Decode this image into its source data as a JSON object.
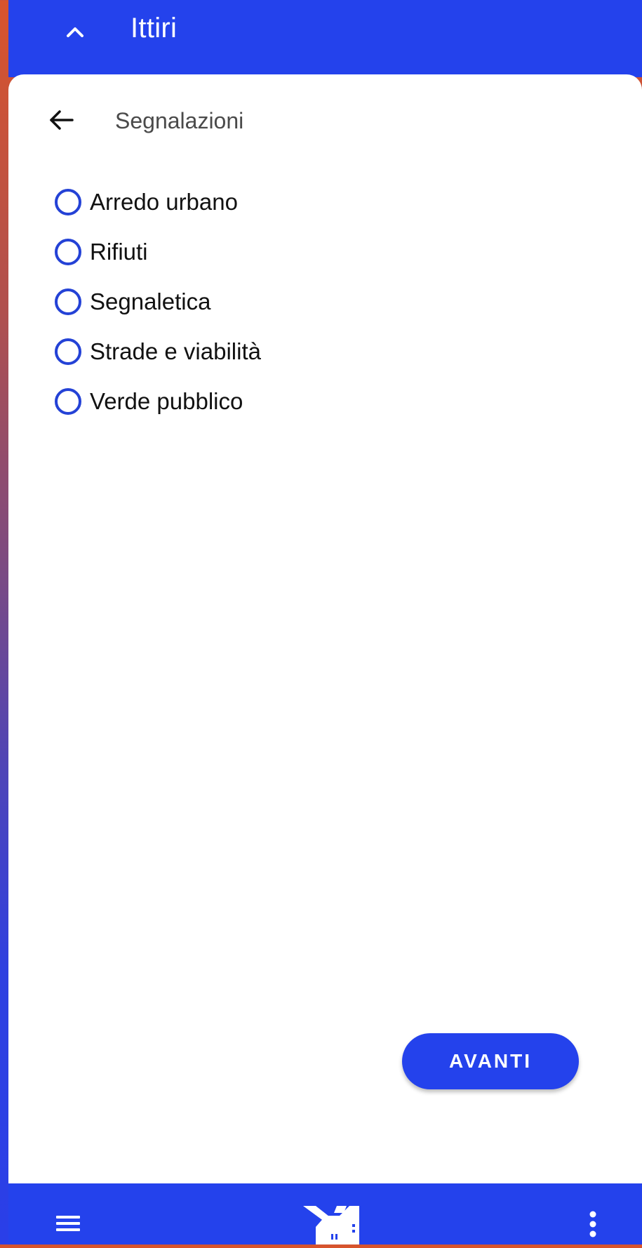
{
  "header": {
    "title": "Ittiri",
    "collapse_icon": "chevron-up-icon",
    "background_color": "#2442ec"
  },
  "page": {
    "title": "Segnalazioni",
    "back_icon": "arrow-left-icon"
  },
  "options": [
    {
      "label": "Arredo urbano",
      "selected": false
    },
    {
      "label": "Rifiuti",
      "selected": false
    },
    {
      "label": "Segnaletica",
      "selected": false
    },
    {
      "label": "Strade e viabilità",
      "selected": false
    },
    {
      "label": "Verde pubblico",
      "selected": false
    }
  ],
  "actions": {
    "next_label": "AVANTI"
  },
  "bottom_bar": {
    "menu_icon": "hamburger-menu-icon",
    "logo": "city-logo",
    "more_icon": "more-vertical-icon"
  },
  "colors": {
    "accent": "#2442ec",
    "radio_border": "#2442d6"
  }
}
